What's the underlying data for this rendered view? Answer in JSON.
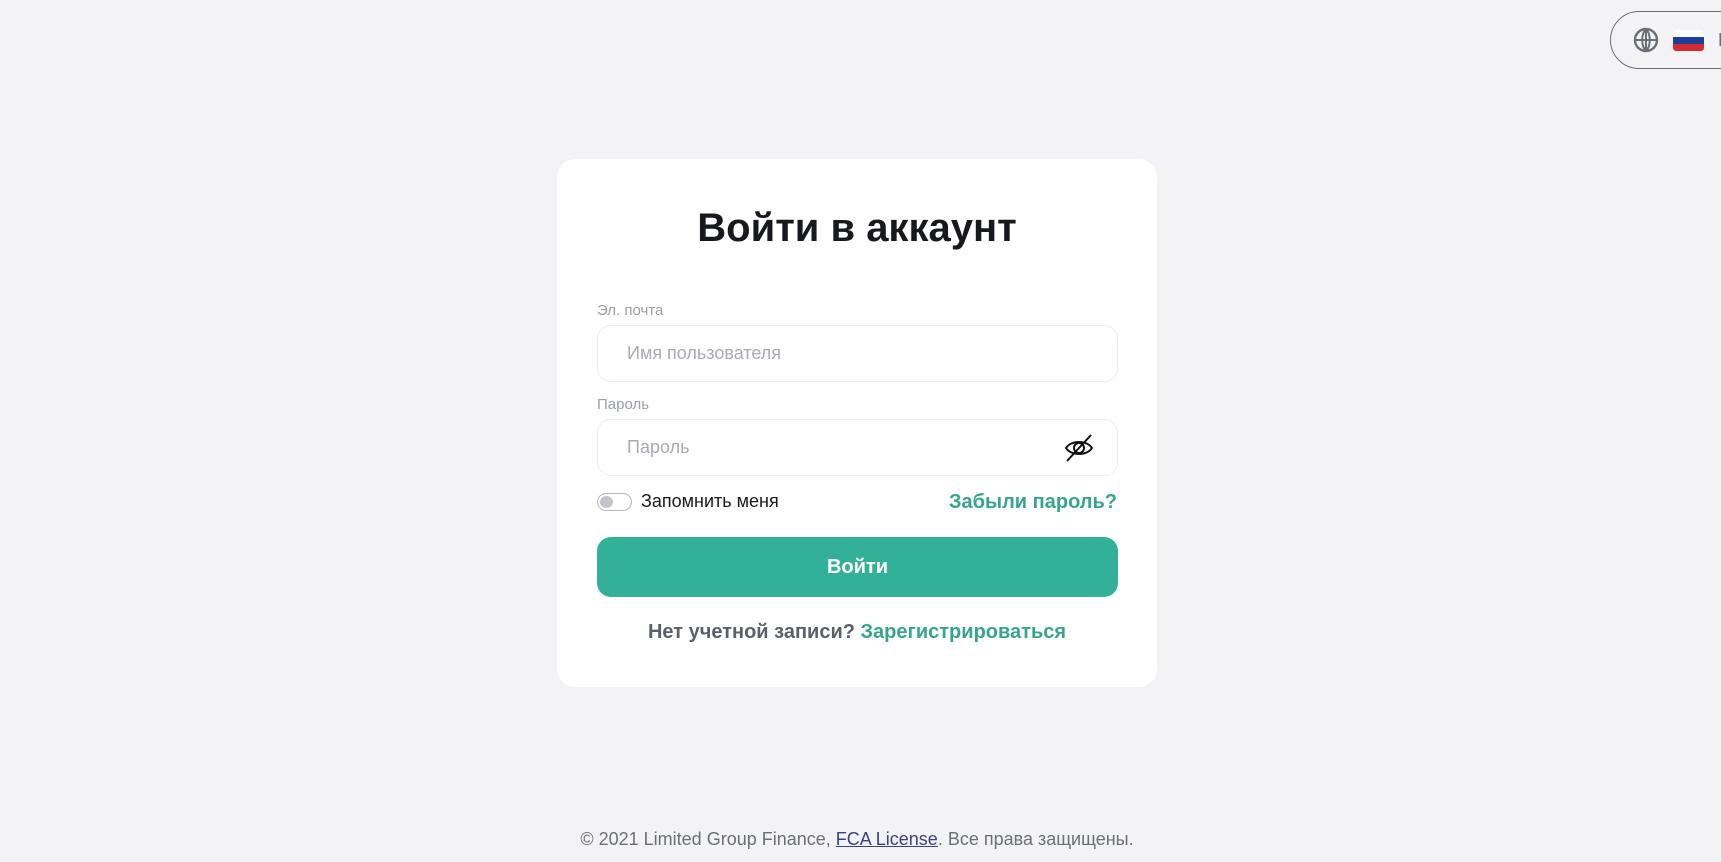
{
  "language": {
    "code": "RU",
    "flag": "russia-flag",
    "icon": "globe-icon"
  },
  "login": {
    "title": "Войти в аккаунт",
    "email_label": "Эл. почта",
    "email_placeholder": "Имя пользователя",
    "email_value": "",
    "password_label": "Пароль",
    "password_placeholder": "Пароль",
    "password_value": "",
    "remember_label": "Запомнить меня",
    "remember_checked": false,
    "forgot_link": "Забыли пароль?",
    "submit_label": "Войти",
    "no_account_text": "Нет учетной записи?",
    "register_link": "Зарегистрироваться"
  },
  "footer": {
    "copyright": "© 2021 Limited Group Finance, ",
    "license_link": "FCA License",
    "rights": ". Все права защищены."
  },
  "colors": {
    "accent": "#33b198",
    "background": "#f3f3f6",
    "card": "#ffffff"
  }
}
